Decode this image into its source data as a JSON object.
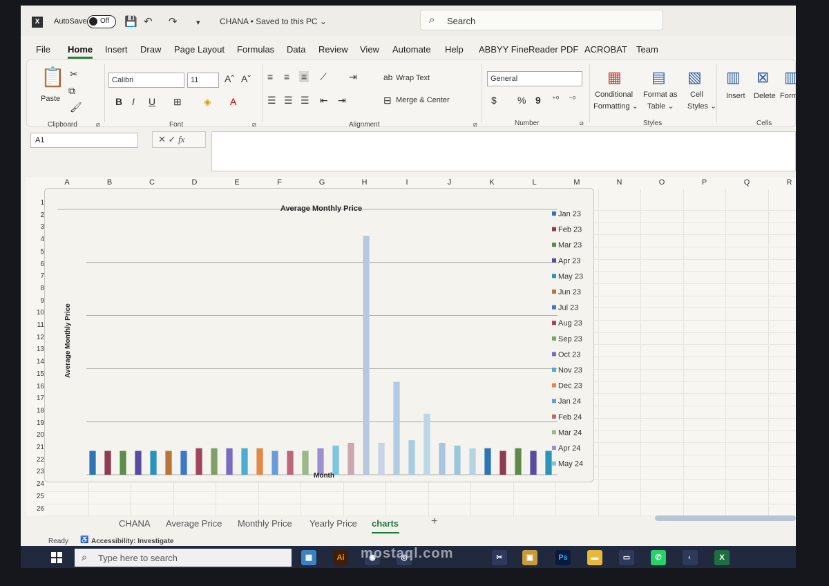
{
  "titlebar": {
    "autosave_label": "AutoSave",
    "autosave_state": "Off",
    "doc_title": "CHANA • Saved to this PC ⌄",
    "search_placeholder": "Search"
  },
  "menu_tabs": [
    "File",
    "Home",
    "Insert",
    "Draw",
    "Page Layout",
    "Formulas",
    "Data",
    "Review",
    "View",
    "Automate",
    "Help",
    "ABBYY FineReader PDF",
    "ACROBAT",
    "Team"
  ],
  "ribbon": {
    "paste_label": "Paste",
    "clipboard_label": "Clipboard",
    "font_name": "Calibri",
    "font_size": "11",
    "font_group_label": "Font",
    "bold": "B",
    "italic": "I",
    "underline": "U",
    "wrap_text": "Wrap Text",
    "merge_center": "Merge & Center",
    "alignment_label": "Alignment",
    "number_format": "General",
    "currency": "$",
    "percent": "%",
    "comma": "9",
    "number_label": "Number",
    "conditional_formatting_1": "Conditional",
    "conditional_formatting_2": "Formatting ⌄",
    "format_as_table_1": "Format as",
    "format_as_table_2": "Table ⌄",
    "cell_styles_1": "Cell",
    "cell_styles_2": "Styles ⌄",
    "styles_label": "Styles",
    "insert": "Insert",
    "delete": "Delete",
    "format": "Form",
    "cells_label": "Cells"
  },
  "formula_bar": {
    "name_box": "A1",
    "fx": "fx"
  },
  "columns": [
    "A",
    "B",
    "C",
    "D",
    "E",
    "F",
    "G",
    "H",
    "I",
    "J",
    "K",
    "L",
    "M",
    "N",
    "O",
    "P",
    "Q",
    "R"
  ],
  "rows": [
    "1",
    "2",
    "3",
    "4",
    "5",
    "6",
    "7",
    "8",
    "9",
    "10",
    "11",
    "12",
    "13",
    "14",
    "15",
    "16",
    "17",
    "18",
    "19",
    "20",
    "21",
    "22",
    "23",
    "24",
    "25",
    "26"
  ],
  "chart_data": {
    "type": "bar",
    "title": "Average Monthly Price",
    "ylabel": "Average Monthly Price",
    "xlabel": "Month",
    "legend_position": "right",
    "grid": true,
    "series": [
      {
        "name": "Jan 23",
        "color": "#2e75b6"
      },
      {
        "name": "Feb 23",
        "color": "#8c3b52"
      },
      {
        "name": "Mar 23",
        "color": "#5e8a4a"
      },
      {
        "name": "Apr 23",
        "color": "#5a4aa0"
      },
      {
        "name": "May 23",
        "color": "#2a94b8"
      },
      {
        "name": "Jun 23",
        "color": "#b8743a"
      },
      {
        "name": "Jul 23",
        "color": "#3d78c8"
      },
      {
        "name": "Aug 23",
        "color": "#a0465c"
      },
      {
        "name": "Sep 23",
        "color": "#7fa066"
      },
      {
        "name": "Oct 23",
        "color": "#7a6ac0"
      },
      {
        "name": "Nov 23",
        "color": "#4aaed0"
      },
      {
        "name": "Dec 23",
        "color": "#e0894a"
      },
      {
        "name": "Jan 24",
        "color": "#6a9ad8"
      },
      {
        "name": "Feb 24",
        "color": "#b8687a"
      },
      {
        "name": "Mar 24",
        "color": "#9ab888"
      },
      {
        "name": "Apr 24",
        "color": "#9c90d0"
      },
      {
        "name": "May 24",
        "color": "#7cc6e0"
      }
    ],
    "bar_colors": [
      "#2e75b6",
      "#8c3b52",
      "#5e8a4a",
      "#5a4aa0",
      "#2a94b8",
      "#b8743a",
      "#3d78c8",
      "#a0465c",
      "#7fa066",
      "#7a6ac0",
      "#4aaed0",
      "#e0894a",
      "#6a9ad8",
      "#b8687a",
      "#9ab888",
      "#9c90d0",
      "#7cc6e0",
      "#c9a8b0",
      "#b8c8de",
      "#c8d4e6",
      "#b0cbe2",
      "#a8cde0",
      "#bcd8e8",
      "#a8c4e0",
      "#9cc6dc",
      "#b4d4e2"
    ],
    "values": [
      9,
      9,
      9,
      9,
      9,
      9,
      9,
      10,
      10,
      10,
      10,
      10,
      9,
      9,
      9,
      10,
      11,
      12,
      90,
      12,
      35,
      13,
      23,
      12,
      11,
      10,
      10,
      9,
      10,
      9,
      9
    ],
    "ylim": [
      0,
      100
    ]
  },
  "sheet_tabs": [
    "CHANA",
    "Average Price",
    "Monthly Price",
    "Yearly Price",
    "charts",
    "+"
  ],
  "status": {
    "ready": "Ready",
    "accessibility": "Accessibility: Investigate"
  },
  "taskbar": {
    "search_placeholder": "Type here to search"
  },
  "watermark": "mostaql.com"
}
